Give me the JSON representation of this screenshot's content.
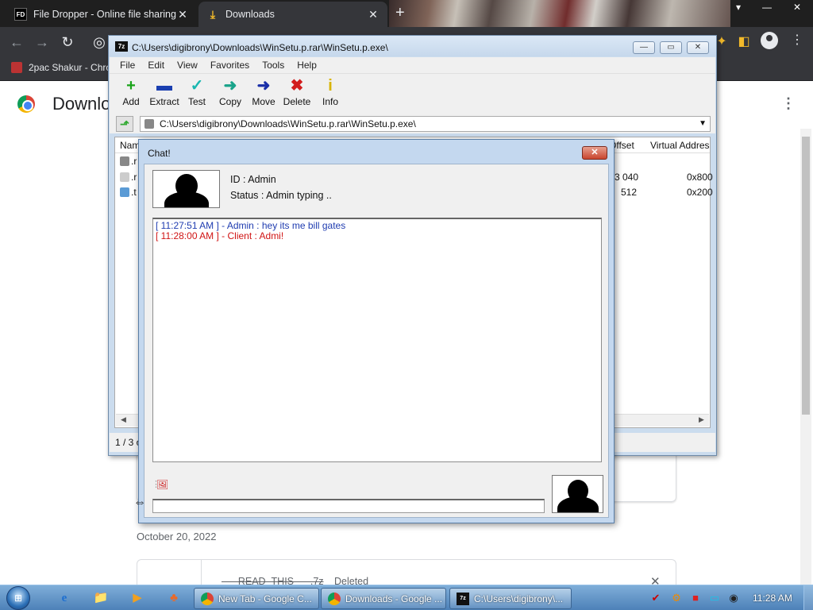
{
  "browser": {
    "tabs": [
      {
        "title": "File Dropper - Online file sharing",
        "favicon": "fd-icon",
        "active": false
      },
      {
        "title": "Downloads",
        "favicon": "download-icon",
        "active": true
      }
    ],
    "new_tab_icon": "+",
    "close_glyph": "✕",
    "bookmark": "2pac Shakur - Chro",
    "window_controls": [
      "▾",
      "▭",
      "—",
      "✕"
    ],
    "nav_glyphs": {
      "back": "←",
      "forward": "→",
      "reload": "↻",
      "menu": "⋮"
    }
  },
  "downloads_page": {
    "title": "Downlo",
    "menu_glyph": "⋮",
    "date": "October 20, 2022",
    "item": {
      "file": "___READ_THIS___.7z",
      "status": "Deleted",
      "remove_glyph": "✕"
    }
  },
  "sevenzip": {
    "title": "C:\\Users\\digibrony\\Downloads\\WinSetu.p.rar\\WinSetu.p.exe\\",
    "menu": [
      "File",
      "Edit",
      "View",
      "Favorites",
      "Tools",
      "Help"
    ],
    "toolbar": [
      {
        "label": "Add",
        "icon": "+",
        "color": "#19a319"
      },
      {
        "label": "Extract",
        "icon": "▬",
        "color": "#1a3fb0"
      },
      {
        "label": "Test",
        "icon": "✓",
        "color": "#19b7b0"
      },
      {
        "label": "Copy",
        "icon": "➜",
        "color": "#19a38a"
      },
      {
        "label": "Move",
        "icon": "➜",
        "color": "#1a2fa8"
      },
      {
        "label": "Delete",
        "icon": "✖",
        "color": "#d21c1c"
      },
      {
        "label": "Info",
        "icon": "i",
        "color": "#d8b400"
      }
    ],
    "address": "C:\\Users\\digibrony\\Downloads\\WinSetu.p.rar\\WinSetu.p.exe\\",
    "columns": {
      "name": "Nam",
      "offset": "Offset",
      "virtual_address": "Virtual Addres"
    },
    "rows": [
      {
        "name": ".r",
        "offset": "",
        "virtual_address": ""
      },
      {
        "name": ".r",
        "offset": "3 040",
        "virtual_address": "0x800"
      },
      {
        "name": ".t",
        "offset": "512",
        "virtual_address": "0x200"
      }
    ],
    "status": "1 / 3 o"
  },
  "chat": {
    "title": "Chat!",
    "close_glyph": "✕",
    "id": "ID : Admin",
    "status": "Status : Admin typing ..",
    "messages": [
      {
        "text": "[ 11:27:51 AM ] - Admin : hey its me bill gates",
        "from": "admin"
      },
      {
        "text": "[ 11:28:00 AM ] - Client : Admi!",
        "from": "client"
      }
    ],
    "input_value": "",
    "attach_icon": "🖼",
    "resize_cursor": "⇔"
  },
  "taskbar": {
    "start_glyph": "⊞",
    "pinned": [
      "e",
      "📁",
      "▶",
      "♣"
    ],
    "tasks": [
      "New Tab - Google C...",
      "Downloads - Google ...",
      "C:\\Users\\digibrony\\..."
    ],
    "tray": [
      "✔",
      "⚙",
      "■",
      "▭",
      "◉"
    ],
    "clock": "11:28 AM"
  }
}
